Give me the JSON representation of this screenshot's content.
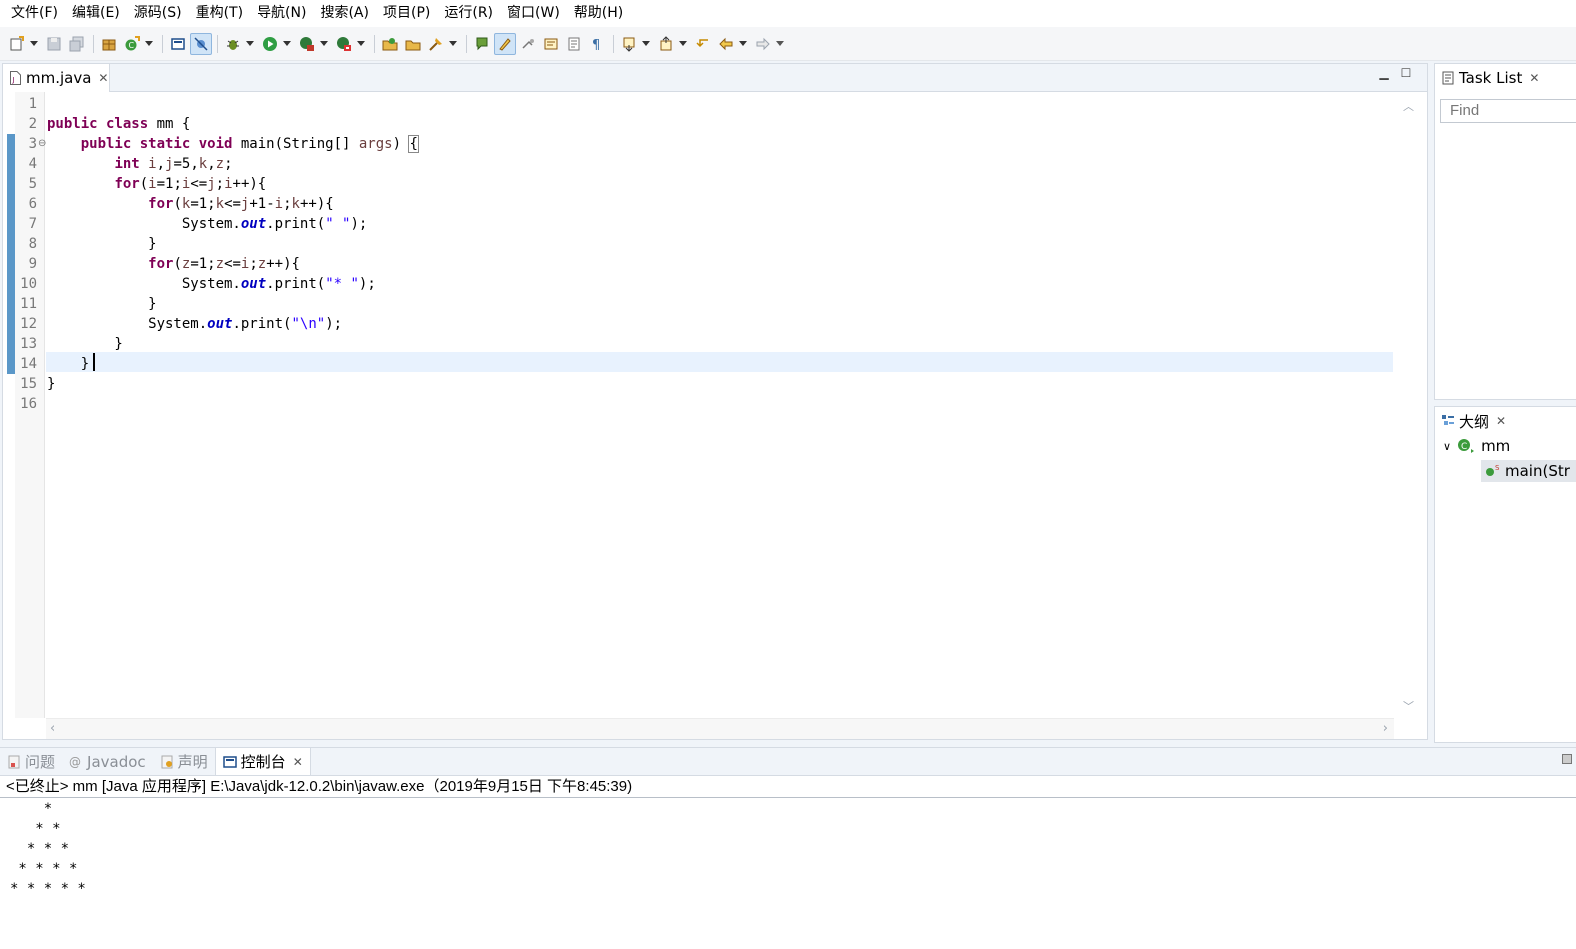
{
  "menubar": {
    "items": [
      "文件(F)",
      "编辑(E)",
      "源码(S)",
      "重构(T)",
      "导航(N)",
      "搜索(A)",
      "项目(P)",
      "运行(R)",
      "窗口(W)",
      "帮助(H)"
    ]
  },
  "editor": {
    "tab_label": "mm.java",
    "line_numbers": [
      "1",
      "2",
      "3",
      "4",
      "5",
      "6",
      "7",
      "8",
      "9",
      "10",
      "11",
      "12",
      "13",
      "14",
      "15",
      "16"
    ],
    "current_line": 14
  },
  "task_list": {
    "tab_label": "Task List",
    "find_placeholder": "Find"
  },
  "outline": {
    "tab_label": "大纲",
    "class_name": "mm",
    "method_name": "main(Str"
  },
  "console": {
    "tabs": [
      "问题",
      "Javadoc",
      "声明",
      "控制台"
    ],
    "active_tab": "控制台",
    "header": "<已终止> mm [Java 应用程序] E:\\Java\\jdk-12.0.2\\bin\\javaw.exe（2019年9月15日 下午8:45:39)",
    "output": [
      "    *",
      "   * *",
      "  * * *",
      " * * * *",
      "* * * * *"
    ]
  },
  "colors": {
    "keyword": "#7f0055",
    "string": "#2a00ff",
    "field": "#0000c0",
    "current_line_bg": "#e8f2fe",
    "change_bar": "#5a97c8"
  }
}
